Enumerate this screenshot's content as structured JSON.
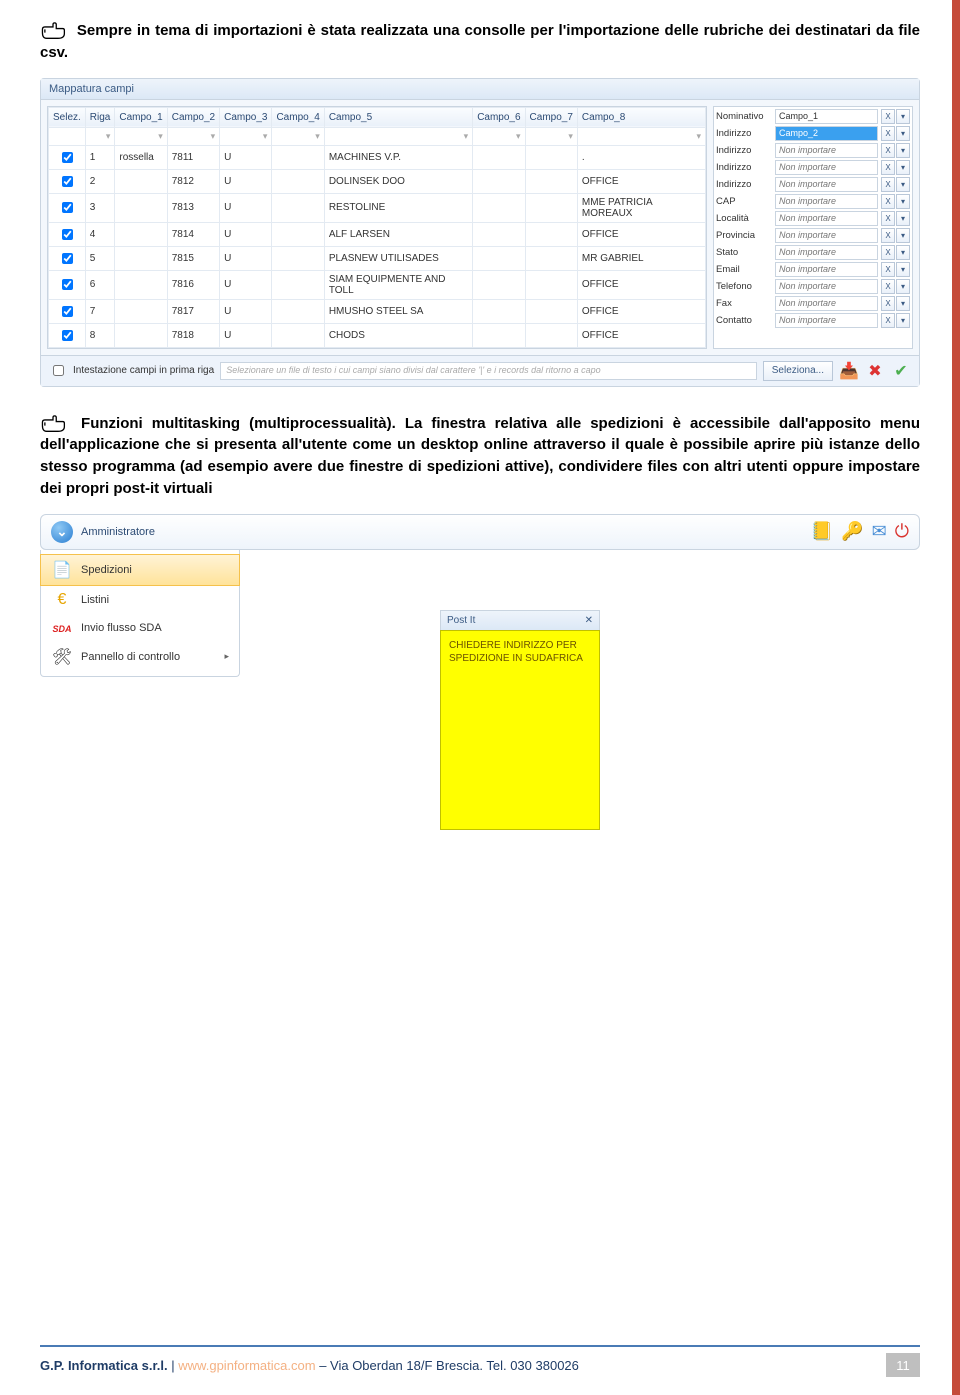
{
  "para1": "Sempre in tema di importazioni è stata realizzata una consolle per l'importazione delle rubriche dei destinatari da file csv.",
  "para2": "Funzioni multitasking (multiprocessualità). La finestra relativa alle spedizioni è accessibile dall'apposito menu dell'applicazione che si presenta all'utente come un desktop online attraverso il quale è possibile aprire più istanze dello stesso programma (ad esempio avere due finestre di spedizioni attive), condividere files con altri utenti oppure impostare dei propri post-it virtuali",
  "win": {
    "title": "Mappatura campi",
    "headers": [
      "Selez.",
      "Riga",
      "Campo_1",
      "Campo_2",
      "Campo_3",
      "Campo_4",
      "Campo_5",
      "Campo_6",
      "Campo_7",
      "Campo_8"
    ],
    "rows": [
      {
        "sel": true,
        "riga": "1",
        "c1": "rossella",
        "c2": "7811",
        "c3": "U",
        "c4": "",
        "c5": "MACHINES V.P.",
        "c6": "",
        "c7": "",
        "c8": "."
      },
      {
        "sel": true,
        "riga": "2",
        "c1": "",
        "c2": "7812",
        "c3": "U",
        "c4": "",
        "c5": "DOLINSEK DOO",
        "c6": "",
        "c7": "",
        "c8": "OFFICE"
      },
      {
        "sel": true,
        "riga": "3",
        "c1": "",
        "c2": "7813",
        "c3": "U",
        "c4": "",
        "c5": "RESTOLINE",
        "c6": "",
        "c7": "",
        "c8": "MME PATRICIA MOREAUX"
      },
      {
        "sel": true,
        "riga": "4",
        "c1": "",
        "c2": "7814",
        "c3": "U",
        "c4": "",
        "c5": "ALF LARSEN",
        "c6": "",
        "c7": "",
        "c8": "OFFICE"
      },
      {
        "sel": true,
        "riga": "5",
        "c1": "",
        "c2": "7815",
        "c3": "U",
        "c4": "",
        "c5": "PLASNEW UTILISADES",
        "c6": "",
        "c7": "",
        "c8": "MR GABRIEL"
      },
      {
        "sel": true,
        "riga": "6",
        "c1": "",
        "c2": "7816",
        "c3": "U",
        "c4": "",
        "c5": "SIAM EQUIPMENTE AND TOLL",
        "c6": "",
        "c7": "",
        "c8": "OFFICE"
      },
      {
        "sel": true,
        "riga": "7",
        "c1": "",
        "c2": "7817",
        "c3": "U",
        "c4": "",
        "c5": "HMUSHO STEEL SA",
        "c6": "",
        "c7": "",
        "c8": "OFFICE"
      },
      {
        "sel": true,
        "riga": "8",
        "c1": "",
        "c2": "7818",
        "c3": "U",
        "c4": "",
        "c5": "CHODS",
        "c6": "",
        "c7": "",
        "c8": "OFFICE"
      }
    ],
    "mapping": [
      {
        "label": "Nominativo",
        "value": "Campo_1",
        "cls": "val"
      },
      {
        "label": "Indirizzo",
        "value": "Campo_2",
        "cls": "sel"
      },
      {
        "label": "Indirizzo",
        "value": "Non importare",
        "cls": ""
      },
      {
        "label": "Indirizzo",
        "value": "Non importare",
        "cls": ""
      },
      {
        "label": "Indirizzo",
        "value": "Non importare",
        "cls": ""
      },
      {
        "label": "CAP",
        "value": "Non importare",
        "cls": ""
      },
      {
        "label": "Località",
        "value": "Non importare",
        "cls": ""
      },
      {
        "label": "Provincia",
        "value": "Non importare",
        "cls": ""
      },
      {
        "label": "Stato",
        "value": "Non importare",
        "cls": ""
      },
      {
        "label": "Email",
        "value": "Non importare",
        "cls": ""
      },
      {
        "label": "Telefono",
        "value": "Non importare",
        "cls": ""
      },
      {
        "label": "Fax",
        "value": "Non importare",
        "cls": ""
      },
      {
        "label": "Contatto",
        "value": "Non importare",
        "cls": ""
      }
    ],
    "footer_check": "Intestazione campi in prima riga",
    "footer_hint": "Selezionare un file di testo i cui campi siano divisi dal carattere '|' e i records dal ritorno a capo",
    "btn_select": "Seleziona..."
  },
  "desk": {
    "label": "Amministratore",
    "menu": [
      {
        "icon": "📄",
        "label": "Spedizioni",
        "sel": true
      },
      {
        "icon": "€",
        "label": "Listini",
        "sel": false,
        "iconColor": "#e6a400"
      },
      {
        "icon": "SDA",
        "label": "Invio flusso SDA",
        "sel": false,
        "sda": true
      },
      {
        "icon": "🛠",
        "label": "Pannello di controllo",
        "sel": false,
        "arrow": true
      }
    ],
    "postit_title": "Post It",
    "postit_text": "CHIEDERE INDIRIZZO PER SPEDIZIONE IN SUDAFRICA"
  },
  "footer": {
    "company": "G.P. Informatica s.r.l.",
    "sep": " | ",
    "link": "www.gpinformatica.com",
    "rest": " – Via Oberdan 18/F Brescia. Tel. 030 380026",
    "page": "11"
  }
}
